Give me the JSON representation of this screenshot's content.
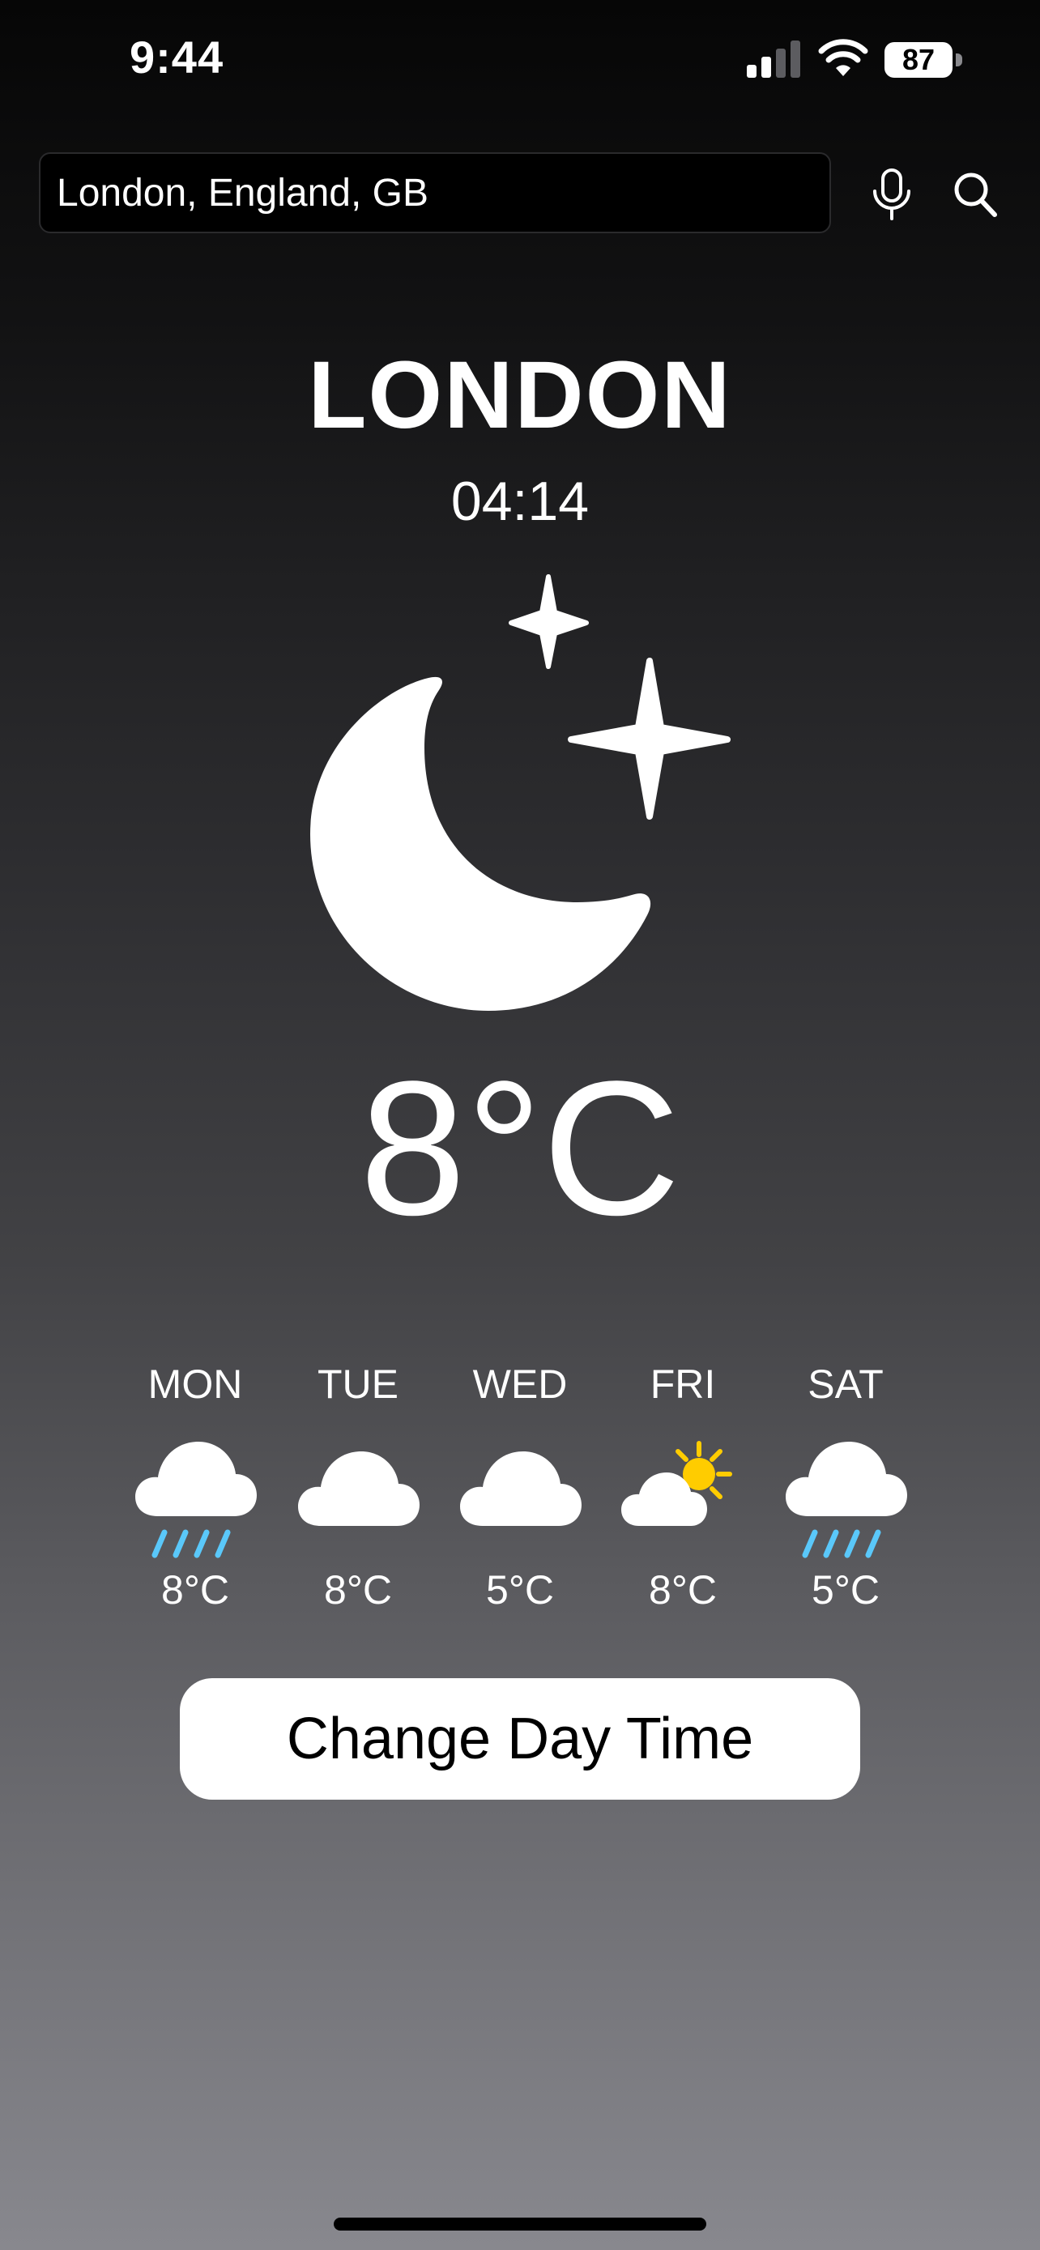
{
  "status_bar": {
    "time": "9:44",
    "battery_percent": "87",
    "signal_bars_active": 2,
    "signal_bars_total": 4
  },
  "search": {
    "value": "London, England, GB",
    "mic_icon": "mic-icon",
    "search_icon": "magnifying-glass-icon"
  },
  "weather": {
    "city": "LONDON",
    "local_time": "04:14",
    "condition_icon": "moon-stars-icon",
    "temperature": "8°C"
  },
  "forecast": [
    {
      "day": "MON",
      "icon": "cloud-rain-icon",
      "temp": "8°C"
    },
    {
      "day": "TUE",
      "icon": "cloud-icon",
      "temp": "8°C"
    },
    {
      "day": "WED",
      "icon": "cloud-icon",
      "temp": "5°C"
    },
    {
      "day": "FRI",
      "icon": "sun-behind-cloud-icon",
      "temp": "8°C"
    },
    {
      "day": "SAT",
      "icon": "cloud-rain-icon",
      "temp": "5°C"
    }
  ],
  "actions": {
    "change_day_time_label": "Change Day Time"
  },
  "colors": {
    "rain": "#5ac8fa",
    "sun": "#ffcc00",
    "button_bg": "#ffffff",
    "background_top": "#060606",
    "background_bottom": "#88888e"
  }
}
